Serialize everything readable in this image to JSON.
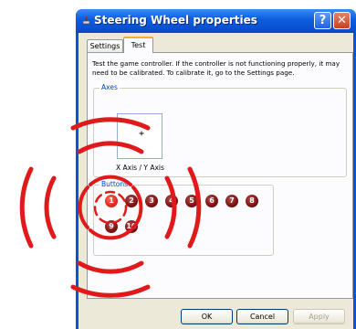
{
  "window": {
    "title": "Steering Wheel properties",
    "help_glyph": "?",
    "close_glyph": "✕"
  },
  "tabs": [
    {
      "label": "Settings",
      "active": false
    },
    {
      "label": "Test",
      "active": true
    }
  ],
  "panel": {
    "description": "Test the game controller.  If the controller is not functioning properly, it may need to be calibrated.  To calibrate it, go to the Settings page.",
    "axes_group_label": "Axes",
    "axis_label": "X Axis / Y Axis",
    "crosshair_glyph": "+",
    "buttons_group_label": "Buttons",
    "buttons": [
      {
        "label": "1",
        "pressed": true
      },
      {
        "label": "2",
        "pressed": false
      },
      {
        "label": "3",
        "pressed": false
      },
      {
        "label": "4",
        "pressed": false
      },
      {
        "label": "5",
        "pressed": false
      },
      {
        "label": "6",
        "pressed": false
      },
      {
        "label": "7",
        "pressed": false
      },
      {
        "label": "8",
        "pressed": false
      },
      {
        "label": "9",
        "pressed": false
      },
      {
        "label": "10",
        "pressed": false
      }
    ]
  },
  "footer": {
    "ok_label": "OK",
    "cancel_label": "Cancel",
    "apply_label": "Apply"
  },
  "colors": {
    "titlebar_blue": "#0a53d6",
    "group_label_blue": "#0046d5",
    "dialog_face": "#ece9d8",
    "highlight_red": "#e01a1a",
    "button_dark_red": "#7a1212"
  },
  "icons": {
    "title_icon": "joystick-icon",
    "help": "help-icon",
    "close": "close-icon"
  }
}
